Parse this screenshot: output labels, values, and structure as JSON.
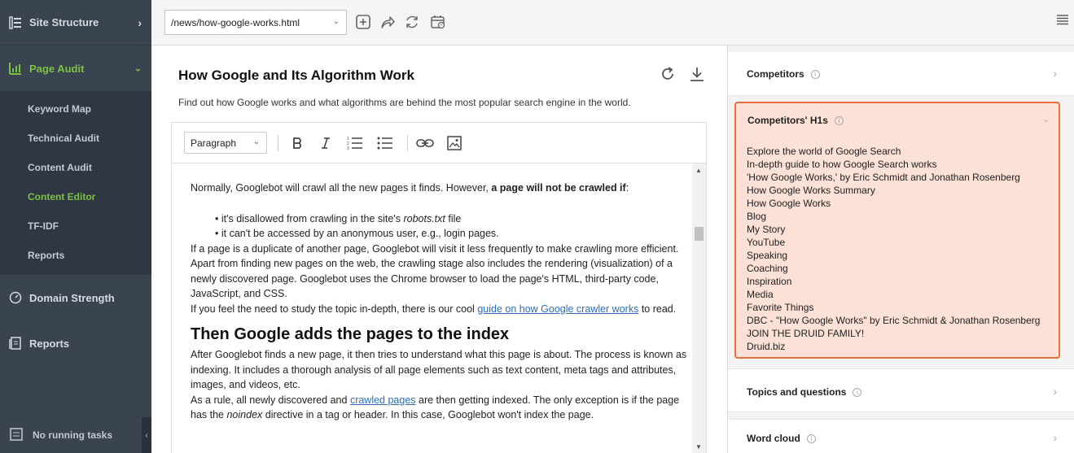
{
  "sidebar": {
    "site_structure": "Site Structure",
    "page_audit": "Page Audit",
    "sub_items": [
      "Keyword Map",
      "Technical Audit",
      "Content Audit",
      "Content Editor",
      "TF-IDF",
      "Reports"
    ],
    "active_sub_item": "Content Editor",
    "domain_strength": "Domain Strength",
    "reports": "Reports",
    "footer": "No running tasks"
  },
  "toolbar": {
    "url_value": "/news/how-google-works.html"
  },
  "editor": {
    "title": "How Google and Its Algorithm Work",
    "description": "Find out how Google works and what algorithms are behind the most popular search engine in the world.",
    "paragraph_style": "Paragraph",
    "body": {
      "p1_a": "Normally, Googlebot will crawl all the new pages it finds. However, ",
      "p1_b": "a page will not be crawled if",
      "p1_c": ":",
      "bullet1_a": "• it's disallowed from crawling in the site's ",
      "bullet1_b": "robots.txt",
      "bullet1_c": " file",
      "bullet2": "• it can't be accessed by an anonymous user, e.g., login pages.",
      "p2": "If a page is a duplicate of another page, Googlebot will visit it less frequently to make crawling more efficient.",
      "p3": "Apart from finding new pages on the web, the crawling stage also includes the rendering (visualization) of a newly discovered page. Googlebot uses the Chrome browser to load the page's HTML, third-party code, JavaScript, and CSS.",
      "p4_a": "If you feel the need to study the topic in-depth, there is our cool ",
      "p4_link": "guide on how Google crawler works",
      "p4_b": " to read.",
      "h2": "Then Google adds the pages to the index",
      "p5": "After Googlebot finds a new page, it then tries to understand what this page is about. The process is known as indexing. It includes a thorough analysis of all page elements such as text content, meta tags and attributes, images, and videos, etc.",
      "p6_a": "As a rule, all newly discovered and ",
      "p6_link": "crawled pages",
      "p6_b": " are then getting indexed. The only exception is if the page has the ",
      "p6_c": "noindex",
      "p6_d": " directive in a tag or header. In this case, Googlebot won't index the page."
    }
  },
  "right_panel": {
    "competitors": "Competitors",
    "competitors_h1s": "Competitors' H1s",
    "h1_list": [
      "Explore the world of Google Search",
      "In-depth guide to how Google Search works",
      "'How Google Works,' by Eric Schmidt and Jonathan Rosenberg",
      "How Google Works Summary",
      "How Google Works",
      "Blog",
      "My Story",
      "YouTube",
      "Speaking",
      "Coaching",
      "Inspiration",
      "Media",
      "Favorite Things",
      "DBC - \"How Google Works\" by Eric Schmidt & Jonathan Rosenberg",
      "JOIN THE DRUID FAMILY!",
      "Druid.biz"
    ],
    "topics": "Topics and questions",
    "word_cloud": "Word cloud",
    "info_glyph": "i"
  },
  "colors": {
    "sidebar_bg": "#3a4350",
    "accent_green": "#7cc242",
    "highlight_bg": "#fde0d6",
    "highlight_border": "#e8703a",
    "link": "#2a6ebb"
  }
}
